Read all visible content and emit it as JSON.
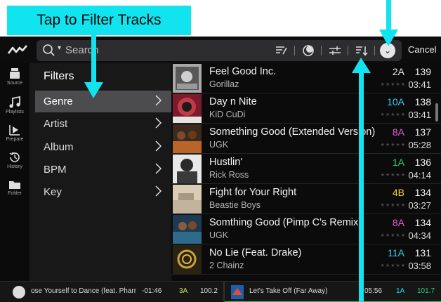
{
  "callout": {
    "text": "Tap to Filter Tracks"
  },
  "colors": {
    "annotation": "#12e4ef",
    "key_blue": "#35d3f0",
    "key_pink": "#e05fd5",
    "key_yellow": "#f2d535",
    "key_green": "#1fd27a",
    "key_lime": "#d8e64a"
  },
  "topbar": {
    "logo_icon": "logo-icon",
    "search_placeholder": "Search",
    "tools": [
      "filter-edit-icon",
      "prepare-icon",
      "swap-icon",
      "sort-icon",
      "download-icon"
    ],
    "cancel_label": "Cancel"
  },
  "rail": {
    "items": [
      {
        "label": "Source",
        "icon": "source-icon"
      },
      {
        "label": "Playlists",
        "icon": "playlist-icon"
      },
      {
        "label": "Prepare",
        "icon": "prepare-icon"
      },
      {
        "label": "History",
        "icon": "history-icon"
      },
      {
        "label": "Folder",
        "icon": "folder-icon"
      }
    ]
  },
  "filters": {
    "title": "Filters",
    "items": [
      {
        "label": "Genre",
        "selected": true
      },
      {
        "label": "Artist",
        "selected": false
      },
      {
        "label": "Album",
        "selected": false
      },
      {
        "label": "BPM",
        "selected": false
      },
      {
        "label": "Key",
        "selected": false
      }
    ]
  },
  "tracks": [
    {
      "title": "Feel Good Inc.",
      "artist": "Gorillaz",
      "key": "2A",
      "key_color": "#e6e6e6",
      "bpm": "139",
      "time": "03:41"
    },
    {
      "title": "Day n Nite",
      "artist": "KiD CuDi",
      "key": "10A",
      "key_color": "#35d3f0",
      "bpm": "138",
      "time": "03:41"
    },
    {
      "title": "Something Good (Extended Version)",
      "artist": "UGK",
      "key": "8A",
      "key_color": "#e05fd5",
      "bpm": "137",
      "time": "05:28"
    },
    {
      "title": "Hustlin'",
      "artist": "Rick Ross",
      "key": "1A",
      "key_color": "#1fd27a",
      "bpm": "136",
      "time": "04:14"
    },
    {
      "title": "Fight for Your Right",
      "artist": "Beastie Boys",
      "key": "4B",
      "key_color": "#f2d535",
      "bpm": "134",
      "time": "03:27"
    },
    {
      "title": "Somthing Good (Pimp C's Remix)",
      "artist": "UGK",
      "key": "8A",
      "key_color": "#e05fd5",
      "bpm": "134",
      "time": "04:34"
    },
    {
      "title": "No Lie (Feat. Drake)",
      "artist": "2 Chainz",
      "key": "11A",
      "key_color": "#35d3f0",
      "bpm": "131",
      "time": "03:58"
    }
  ],
  "stars": "★★★★★",
  "deck_left": {
    "title": "ose Yourself to Dance (feat. Pharr",
    "time": "-01:46",
    "key": "3A",
    "bpm": "100.2"
  },
  "deck_right": {
    "title": "Let's Take Off (Far Away)",
    "time": "05:56",
    "key": "1A",
    "bpm": "101.7"
  }
}
